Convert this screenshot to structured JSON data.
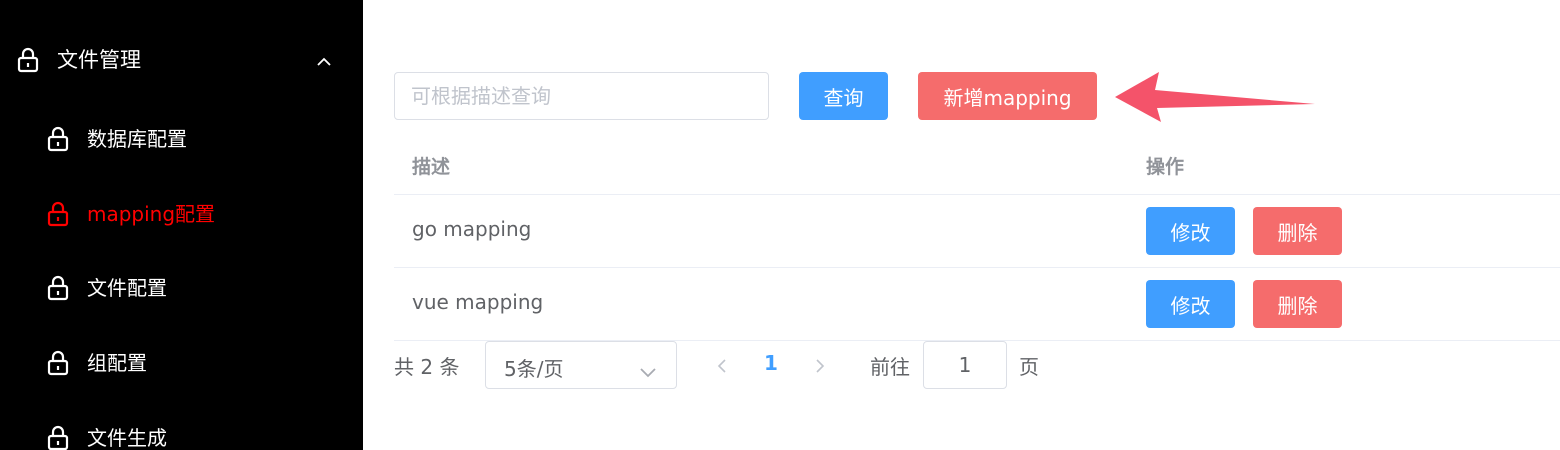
{
  "sidebar": {
    "group_title": "文件管理",
    "items": [
      {
        "label": "数据库配置",
        "active": false
      },
      {
        "label": "mapping配置",
        "active": true
      },
      {
        "label": "文件配置",
        "active": false
      },
      {
        "label": "组配置",
        "active": false
      },
      {
        "label": "文件生成",
        "active": false
      }
    ]
  },
  "toolbar": {
    "search_placeholder": "可根据描述查询",
    "search_value": "",
    "query_label": "查询",
    "add_label": "新增mapping"
  },
  "table": {
    "columns": [
      "描述",
      "操作"
    ],
    "rows": [
      {
        "desc": "go mapping",
        "edit": "修改",
        "delete": "删除"
      },
      {
        "desc": "vue mapping",
        "edit": "修改",
        "delete": "删除"
      }
    ]
  },
  "pagination": {
    "total_text": "共 2 条",
    "page_size": "5条/页",
    "current_page": "1",
    "goto_label": "前往",
    "goto_value": "1",
    "page_suffix": "页"
  },
  "colors": {
    "primary": "#409eff",
    "danger": "#f56c6c",
    "active_menu": "#ff0000",
    "arrow": "#f4536a"
  }
}
